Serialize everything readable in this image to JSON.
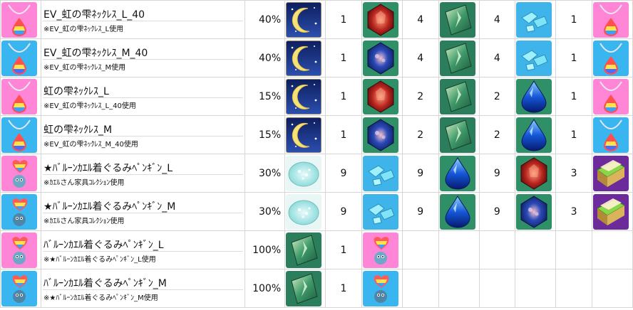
{
  "rows": [
    {
      "name": "EV_虹の雫ﾈｯｸﾚｽ_L_40",
      "note": "※EV_虹の雫ﾈｯｸﾚｽ_L使用",
      "rate": "40%",
      "item_icon": "necklace-l",
      "result_icon": "necklace-l",
      "materials": [
        {
          "icon": "moon-icon",
          "qty": "1"
        },
        {
          "icon": "red-crystal-icon",
          "qty": "4"
        },
        {
          "icon": "green-shard-icon",
          "qty": "4"
        },
        {
          "icon": "aqua-fragment-icon",
          "qty": "1"
        }
      ]
    },
    {
      "name": "EV_虹の雫ﾈｯｸﾚｽ_M_40",
      "note": "※EV_虹の雫ﾈｯｸﾚｽ_M使用",
      "rate": "40%",
      "item_icon": "necklace-m",
      "result_icon": "necklace-m",
      "materials": [
        {
          "icon": "moon-icon",
          "qty": "1"
        },
        {
          "icon": "blue-crystal-icon",
          "qty": "4"
        },
        {
          "icon": "green-shard-icon",
          "qty": "4"
        },
        {
          "icon": "aqua-fragment-icon",
          "qty": "1"
        }
      ]
    },
    {
      "name": "虹の雫ﾈｯｸﾚｽ_L",
      "note": "※EV_虹の雫ﾈｯｸﾚｽ_L_40使用",
      "rate": "15%",
      "item_icon": "necklace-l",
      "result_icon": "necklace-l",
      "materials": [
        {
          "icon": "moon-icon",
          "qty": "1"
        },
        {
          "icon": "red-crystal-icon",
          "qty": "2"
        },
        {
          "icon": "green-shard-icon",
          "qty": "2"
        },
        {
          "icon": "blue-drop-icon",
          "qty": "1"
        }
      ]
    },
    {
      "name": "虹の雫ﾈｯｸﾚｽ_M",
      "note": "※EV_虹の雫ﾈｯｸﾚｽ_M_40使用",
      "rate": "15%",
      "item_icon": "necklace-m",
      "result_icon": "necklace-m",
      "materials": [
        {
          "icon": "moon-icon",
          "qty": "1"
        },
        {
          "icon": "blue-crystal-icon",
          "qty": "2"
        },
        {
          "icon": "green-shard-icon",
          "qty": "2"
        },
        {
          "icon": "blue-drop-icon",
          "qty": "1"
        }
      ]
    },
    {
      "name": "★ﾊﾞﾙｰﾝｶｴﾙ着ぐるみﾍﾟﾝｷﾞﾝ_L",
      "note": "※ｶｴﾙさん家具ｺﾚｸｼｮﾝ使用",
      "rate": "30%",
      "item_icon": "penguin-l",
      "result_icon": "furniture",
      "materials": [
        {
          "icon": "powder-icon",
          "qty": "9"
        },
        {
          "icon": "aqua-fragment-icon",
          "qty": "9"
        },
        {
          "icon": "blue-drop-icon",
          "qty": "9"
        },
        {
          "icon": "red-crystal-icon",
          "qty": "3"
        }
      ]
    },
    {
      "name": "★ﾊﾞﾙｰﾝｶｴﾙ着ぐるみﾍﾟﾝｷﾞﾝ_M",
      "note": "※ｶｴﾙさん家具ｺﾚｸｼｮﾝ使用",
      "rate": "30%",
      "item_icon": "penguin-m",
      "result_icon": "furniture",
      "materials": [
        {
          "icon": "powder-icon",
          "qty": "9"
        },
        {
          "icon": "aqua-fragment-icon",
          "qty": "9"
        },
        {
          "icon": "blue-drop-icon",
          "qty": "9"
        },
        {
          "icon": "blue-crystal-icon",
          "qty": "3"
        }
      ]
    },
    {
      "name": "ﾊﾞﾙｰﾝｶｴﾙ着ぐるみﾍﾟﾝｷﾞﾝ_L",
      "note": "※★ﾊﾞﾙｰﾝｶｴﾙ着ぐるみﾍﾟﾝｷﾞﾝ_L使用",
      "rate": "100%",
      "item_icon": "penguin-l",
      "result_icon": "penguin-l",
      "materials": [
        {
          "icon": "green-shard-icon",
          "qty": "1"
        }
      ]
    },
    {
      "name": "ﾊﾞﾙｰﾝｶｴﾙ着ぐるみﾍﾟﾝｷﾞﾝ_M",
      "note": "※★ﾊﾞﾙｰﾝｶｴﾙ着ぐるみﾍﾟﾝｷﾞﾝ_M使用",
      "rate": "100%",
      "item_icon": "penguin-m",
      "result_icon": "penguin-m",
      "materials": [
        {
          "icon": "green-shard-icon",
          "qty": "1"
        }
      ]
    }
  ]
}
